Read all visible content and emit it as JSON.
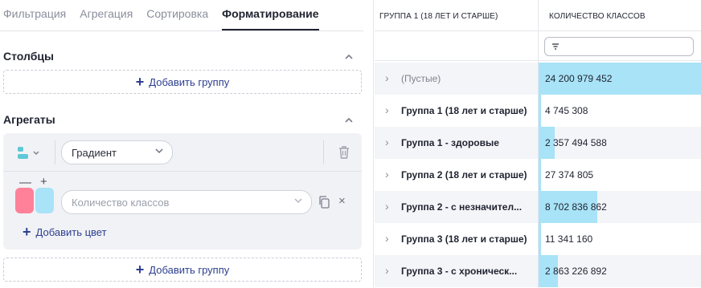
{
  "tabs": [
    "Фильтрация",
    "Агрегация",
    "Сортировка",
    "Форматирование"
  ],
  "active_tab": "Форматирование",
  "columns_section": {
    "title": "Столбцы",
    "add_group_label": "Добавить группу"
  },
  "aggregates_section": {
    "title": "Агрегаты",
    "format_type_select": "Градиент",
    "field_select_placeholder": "Количество классов",
    "add_color_label": "Добавить цвет",
    "minus": "—",
    "plus": "+",
    "remove": "×",
    "colors": [
      "#ff8099",
      "#a8e3f7"
    ],
    "add_group_label": "Добавить группу"
  },
  "table": {
    "headers": [
      "ГРУППА 1 (18 ЛЕТ И СТАРШЕ)",
      "КОЛИЧЕСТВО КЛАССОВ"
    ],
    "bar_color": "#a8e3f7",
    "max_value": 24200979452,
    "rows": [
      {
        "label": "(Пустые)",
        "value": "24 200 979 452",
        "num": 24200979452,
        "muted": true
      },
      {
        "label": "Группа 1 (18 лет и старше)",
        "value": "4 745 308",
        "num": 4745308
      },
      {
        "label": "Группа 1 - здоровые",
        "value": "2 357 494 588",
        "num": 2357494588
      },
      {
        "label": "Группа 2 (18 лет и старше)",
        "value": "27 374 805",
        "num": 27374805
      },
      {
        "label": "Группа 2 - с незначител...",
        "value": "8 702 836 862",
        "num": 8702836862
      },
      {
        "label": "Группа 3 (18 лет и старше)",
        "value": "11 341 160",
        "num": 11341160
      },
      {
        "label": "Группа 3 - с хроническ...",
        "value": "2 863 226 892",
        "num": 2863226892
      }
    ]
  }
}
